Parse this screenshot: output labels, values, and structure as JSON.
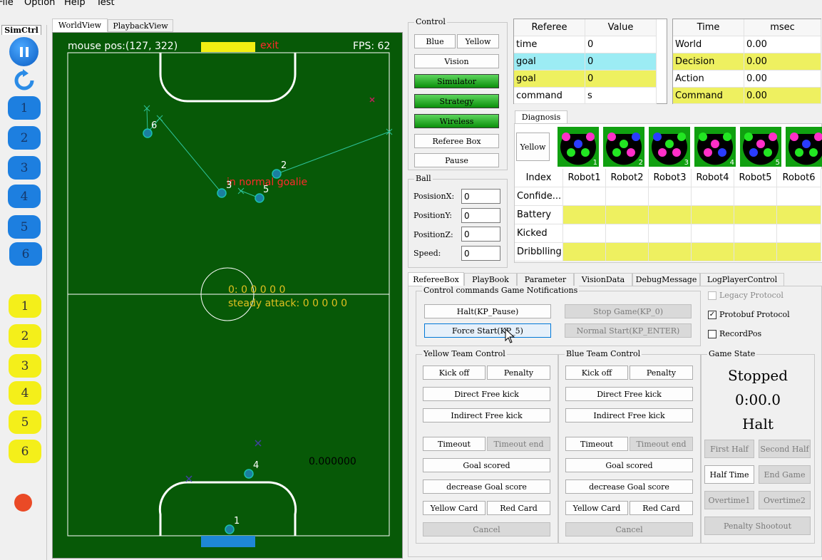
{
  "menu": [
    "File",
    "Option",
    "Help",
    "Test"
  ],
  "sim_tab": "SimCtrl",
  "view_tabs": [
    "WorldView",
    "PlaybackView"
  ],
  "field": {
    "mouse_pos": "mouse pos:(127, 322)",
    "exit": "exit",
    "fps": "FPS: 62",
    "center_label1": "0: 0 0 0 0 0",
    "center_label2": "steady attack: 0 0 0 0 0",
    "goalie_label": "in normal goalie",
    "value_label": "0.000000",
    "robot_labels": [
      "6",
      "2",
      "3",
      "5",
      "4",
      "1"
    ]
  },
  "side_buttons": {
    "blue": [
      "1",
      "2",
      "3",
      "4",
      "5",
      "6"
    ],
    "yellow": [
      "1",
      "2",
      "3",
      "4",
      "5",
      "6"
    ]
  },
  "control": {
    "title": "Control",
    "blue": "Blue",
    "yellow": "Yellow",
    "vision": "Vision",
    "simulator": "Simulator",
    "strategy": "Strategy",
    "wireless": "Wireless",
    "referee_box": "Referee Box",
    "pause": "Pause"
  },
  "ball": {
    "title": "Ball",
    "fields": [
      {
        "label": "PosisionX:",
        "value": "0"
      },
      {
        "label": "PositionY:",
        "value": "0"
      },
      {
        "label": "PositionZ:",
        "value": "0"
      },
      {
        "label": "Speed:",
        "value": "0"
      }
    ]
  },
  "referee_table": {
    "headers": [
      "Referee",
      "Value"
    ],
    "rows": [
      [
        "time",
        "0"
      ],
      [
        "goal",
        "0"
      ],
      [
        "goal",
        "0"
      ],
      [
        "command",
        "s"
      ]
    ]
  },
  "time_table": {
    "headers": [
      "Time",
      "msec"
    ],
    "rows": [
      [
        "World",
        "0.00"
      ],
      [
        "Decision",
        "0.00"
      ],
      [
        "Action",
        "0.00"
      ],
      [
        "Command",
        "0.00"
      ]
    ]
  },
  "diagnosis": {
    "tab": "Diagnosis",
    "yellow": "Yellow",
    "robot_numbers": [
      "1",
      "2",
      "3",
      "4",
      "5"
    ],
    "headers": [
      "Index",
      "Robot1",
      "Robot2",
      "Robot3",
      "Robot4",
      "Robot5",
      "Robot6"
    ],
    "rows": [
      "Confide...",
      "Battery",
      "Kicked",
      "Dribblling"
    ]
  },
  "bottom_tabs": [
    "RefereeBox",
    "PlayBook",
    "Parameter",
    "VisionData",
    "DebugMessage",
    "LogPlayerControl"
  ],
  "refbox": {
    "group_title": "Control commands Game Notifications",
    "halt": "Halt(KP_Pause)",
    "stop": "Stop Game(KP_0)",
    "force": "Force Start(KP_5)",
    "normal": "Normal Start(KP_ENTER)",
    "legacy": "Legacy Protocol",
    "protobuf": "Protobuf Protocol",
    "recordpos": "RecordPos"
  },
  "yellow_team": {
    "title": "Yellow Team Control",
    "kickoff": "Kick off",
    "penalty": "Penalty",
    "direct": "Direct Free kick",
    "indirect": "Indirect Free kick",
    "timeout": "Timeout",
    "timeout_end": "Timeout end",
    "goal": "Goal scored",
    "decrease": "decrease Goal score",
    "yellow_card": "Yellow Card",
    "red_card": "Red Card",
    "cancel": "Cancel"
  },
  "blue_team": {
    "title": "Blue Team Control",
    "kickoff": "Kick off",
    "penalty": "Penalty",
    "direct": "Direct Free kick",
    "indirect": "Indirect Free kick",
    "timeout": "Timeout",
    "timeout_end": "Timeout end",
    "goal": "Goal scored",
    "decrease": "decrease Goal score",
    "yellow_card": "Yellow Card",
    "red_card": "Red Card",
    "cancel": "Cancel"
  },
  "game_state": {
    "title": "Game State",
    "state": "Stopped",
    "clock": "0:00.0",
    "command": "Halt",
    "first_half": "First Half",
    "second_half": "Second Half",
    "half_time": "Half Time",
    "end_game": "End Game",
    "overtime1": "Overtime1",
    "overtime2": "Overtime2",
    "shootout": "Penalty Shootout"
  },
  "colors": {
    "field": "#075907",
    "highlight_cyan": "#9cecf4",
    "highlight_yellow": "#eef060",
    "blue_btn": "#1d7fe0",
    "yellow_btn": "#f4ef1a"
  }
}
